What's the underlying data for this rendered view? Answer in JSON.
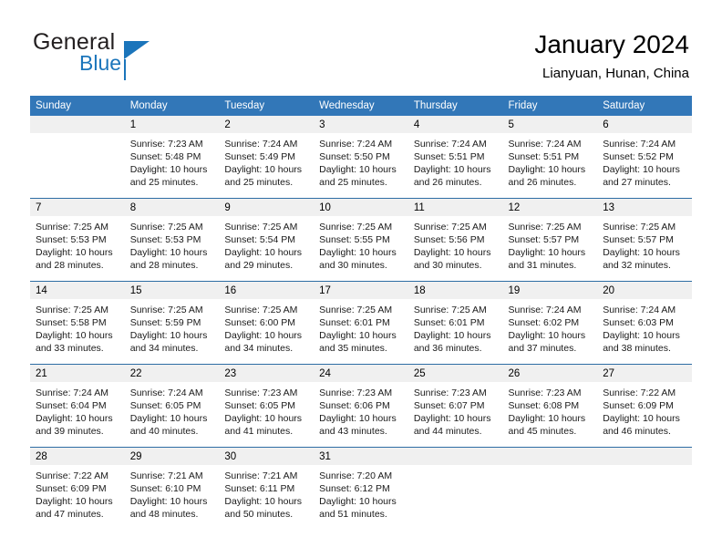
{
  "brand": {
    "name_part1": "General",
    "name_part2": "Blue",
    "accent_color": "#1b75bb"
  },
  "header": {
    "title": "January 2024",
    "subtitle": "Lianyuan, Hunan, China"
  },
  "theme": {
    "header_blue": "#3277b8",
    "row_divider": "#2e6da4",
    "date_band": "#f0f0f0"
  },
  "calendar": {
    "weekday_headers": [
      "Sunday",
      "Monday",
      "Tuesday",
      "Wednesday",
      "Thursday",
      "Friday",
      "Saturday"
    ],
    "weeks": [
      [
        {
          "day": "",
          "sunrise": "",
          "sunset": "",
          "daylight1": "",
          "daylight2": "",
          "empty": true
        },
        {
          "day": "1",
          "sunrise": "Sunrise: 7:23 AM",
          "sunset": "Sunset: 5:48 PM",
          "daylight1": "Daylight: 10 hours",
          "daylight2": "and 25 minutes."
        },
        {
          "day": "2",
          "sunrise": "Sunrise: 7:24 AM",
          "sunset": "Sunset: 5:49 PM",
          "daylight1": "Daylight: 10 hours",
          "daylight2": "and 25 minutes."
        },
        {
          "day": "3",
          "sunrise": "Sunrise: 7:24 AM",
          "sunset": "Sunset: 5:50 PM",
          "daylight1": "Daylight: 10 hours",
          "daylight2": "and 25 minutes."
        },
        {
          "day": "4",
          "sunrise": "Sunrise: 7:24 AM",
          "sunset": "Sunset: 5:51 PM",
          "daylight1": "Daylight: 10 hours",
          "daylight2": "and 26 minutes."
        },
        {
          "day": "5",
          "sunrise": "Sunrise: 7:24 AM",
          "sunset": "Sunset: 5:51 PM",
          "daylight1": "Daylight: 10 hours",
          "daylight2": "and 26 minutes."
        },
        {
          "day": "6",
          "sunrise": "Sunrise: 7:24 AM",
          "sunset": "Sunset: 5:52 PM",
          "daylight1": "Daylight: 10 hours",
          "daylight2": "and 27 minutes."
        }
      ],
      [
        {
          "day": "7",
          "sunrise": "Sunrise: 7:25 AM",
          "sunset": "Sunset: 5:53 PM",
          "daylight1": "Daylight: 10 hours",
          "daylight2": "and 28 minutes."
        },
        {
          "day": "8",
          "sunrise": "Sunrise: 7:25 AM",
          "sunset": "Sunset: 5:53 PM",
          "daylight1": "Daylight: 10 hours",
          "daylight2": "and 28 minutes."
        },
        {
          "day": "9",
          "sunrise": "Sunrise: 7:25 AM",
          "sunset": "Sunset: 5:54 PM",
          "daylight1": "Daylight: 10 hours",
          "daylight2": "and 29 minutes."
        },
        {
          "day": "10",
          "sunrise": "Sunrise: 7:25 AM",
          "sunset": "Sunset: 5:55 PM",
          "daylight1": "Daylight: 10 hours",
          "daylight2": "and 30 minutes."
        },
        {
          "day": "11",
          "sunrise": "Sunrise: 7:25 AM",
          "sunset": "Sunset: 5:56 PM",
          "daylight1": "Daylight: 10 hours",
          "daylight2": "and 30 minutes."
        },
        {
          "day": "12",
          "sunrise": "Sunrise: 7:25 AM",
          "sunset": "Sunset: 5:57 PM",
          "daylight1": "Daylight: 10 hours",
          "daylight2": "and 31 minutes."
        },
        {
          "day": "13",
          "sunrise": "Sunrise: 7:25 AM",
          "sunset": "Sunset: 5:57 PM",
          "daylight1": "Daylight: 10 hours",
          "daylight2": "and 32 minutes."
        }
      ],
      [
        {
          "day": "14",
          "sunrise": "Sunrise: 7:25 AM",
          "sunset": "Sunset: 5:58 PM",
          "daylight1": "Daylight: 10 hours",
          "daylight2": "and 33 minutes."
        },
        {
          "day": "15",
          "sunrise": "Sunrise: 7:25 AM",
          "sunset": "Sunset: 5:59 PM",
          "daylight1": "Daylight: 10 hours",
          "daylight2": "and 34 minutes."
        },
        {
          "day": "16",
          "sunrise": "Sunrise: 7:25 AM",
          "sunset": "Sunset: 6:00 PM",
          "daylight1": "Daylight: 10 hours",
          "daylight2": "and 34 minutes."
        },
        {
          "day": "17",
          "sunrise": "Sunrise: 7:25 AM",
          "sunset": "Sunset: 6:01 PM",
          "daylight1": "Daylight: 10 hours",
          "daylight2": "and 35 minutes."
        },
        {
          "day": "18",
          "sunrise": "Sunrise: 7:25 AM",
          "sunset": "Sunset: 6:01 PM",
          "daylight1": "Daylight: 10 hours",
          "daylight2": "and 36 minutes."
        },
        {
          "day": "19",
          "sunrise": "Sunrise: 7:24 AM",
          "sunset": "Sunset: 6:02 PM",
          "daylight1": "Daylight: 10 hours",
          "daylight2": "and 37 minutes."
        },
        {
          "day": "20",
          "sunrise": "Sunrise: 7:24 AM",
          "sunset": "Sunset: 6:03 PM",
          "daylight1": "Daylight: 10 hours",
          "daylight2": "and 38 minutes."
        }
      ],
      [
        {
          "day": "21",
          "sunrise": "Sunrise: 7:24 AM",
          "sunset": "Sunset: 6:04 PM",
          "daylight1": "Daylight: 10 hours",
          "daylight2": "and 39 minutes."
        },
        {
          "day": "22",
          "sunrise": "Sunrise: 7:24 AM",
          "sunset": "Sunset: 6:05 PM",
          "daylight1": "Daylight: 10 hours",
          "daylight2": "and 40 minutes."
        },
        {
          "day": "23",
          "sunrise": "Sunrise: 7:23 AM",
          "sunset": "Sunset: 6:05 PM",
          "daylight1": "Daylight: 10 hours",
          "daylight2": "and 41 minutes."
        },
        {
          "day": "24",
          "sunrise": "Sunrise: 7:23 AM",
          "sunset": "Sunset: 6:06 PM",
          "daylight1": "Daylight: 10 hours",
          "daylight2": "and 43 minutes."
        },
        {
          "day": "25",
          "sunrise": "Sunrise: 7:23 AM",
          "sunset": "Sunset: 6:07 PM",
          "daylight1": "Daylight: 10 hours",
          "daylight2": "and 44 minutes."
        },
        {
          "day": "26",
          "sunrise": "Sunrise: 7:23 AM",
          "sunset": "Sunset: 6:08 PM",
          "daylight1": "Daylight: 10 hours",
          "daylight2": "and 45 minutes."
        },
        {
          "day": "27",
          "sunrise": "Sunrise: 7:22 AM",
          "sunset": "Sunset: 6:09 PM",
          "daylight1": "Daylight: 10 hours",
          "daylight2": "and 46 minutes."
        }
      ],
      [
        {
          "day": "28",
          "sunrise": "Sunrise: 7:22 AM",
          "sunset": "Sunset: 6:09 PM",
          "daylight1": "Daylight: 10 hours",
          "daylight2": "and 47 minutes."
        },
        {
          "day": "29",
          "sunrise": "Sunrise: 7:21 AM",
          "sunset": "Sunset: 6:10 PM",
          "daylight1": "Daylight: 10 hours",
          "daylight2": "and 48 minutes."
        },
        {
          "day": "30",
          "sunrise": "Sunrise: 7:21 AM",
          "sunset": "Sunset: 6:11 PM",
          "daylight1": "Daylight: 10 hours",
          "daylight2": "and 50 minutes."
        },
        {
          "day": "31",
          "sunrise": "Sunrise: 7:20 AM",
          "sunset": "Sunset: 6:12 PM",
          "daylight1": "Daylight: 10 hours",
          "daylight2": "and 51 minutes."
        },
        {
          "day": "",
          "sunrise": "",
          "sunset": "",
          "daylight1": "",
          "daylight2": "",
          "empty": true
        },
        {
          "day": "",
          "sunrise": "",
          "sunset": "",
          "daylight1": "",
          "daylight2": "",
          "empty": true
        },
        {
          "day": "",
          "sunrise": "",
          "sunset": "",
          "daylight1": "",
          "daylight2": "",
          "empty": true
        }
      ]
    ]
  }
}
